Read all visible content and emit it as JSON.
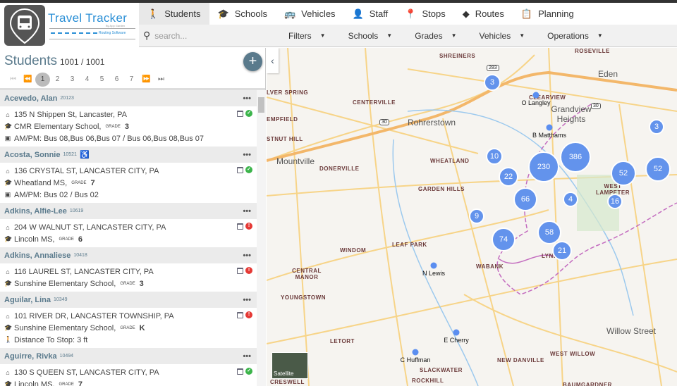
{
  "app": {
    "title": "Travel Tracker",
    "by": "By App Garden",
    "subtitle": "Routing Software"
  },
  "nav": [
    {
      "label": "Students",
      "icon": "walking-icon"
    },
    {
      "label": "Schools",
      "icon": "graduation-cap-icon"
    },
    {
      "label": "Vehicles",
      "icon": "bus-icon"
    },
    {
      "label": "Staff",
      "icon": "person-icon"
    },
    {
      "label": "Stops",
      "icon": "map-pin-icon"
    },
    {
      "label": "Routes",
      "icon": "directions-icon"
    },
    {
      "label": "Planning",
      "icon": "clipboard-icon"
    }
  ],
  "search": {
    "placeholder": "search..."
  },
  "filters": [
    "Filters",
    "Schools",
    "Grades",
    "Vehicles",
    "Operations"
  ],
  "panel": {
    "title": "Students",
    "count": "1001 / 1001",
    "pages": [
      "1",
      "2",
      "3",
      "4",
      "5",
      "6",
      "7"
    ],
    "add": "+"
  },
  "grade_label": "GRADE",
  "students": [
    {
      "name": "Acevedo, Alan",
      "id": "20123",
      "address": "135 N Shippen St, Lancaster, PA",
      "school": "CMR Elementary School,",
      "grade": "3",
      "extra": "AM/PM: Bus 08,Bus 06,Bus 07 / Bus 06,Bus 08,Bus 07",
      "status": "ok"
    },
    {
      "name": "Acosta, Sonnie",
      "id": "10521",
      "address": "136 CRYSTAL ST, LANCASTER CITY, PA",
      "school": "Wheatland MS,",
      "grade": "7",
      "extra": "AM/PM: Bus 02 / Bus 02",
      "status": "ok",
      "wheelchair": true
    },
    {
      "name": "Adkins, Alfie-Lee",
      "id": "10619",
      "address": "204 W WALNUT ST, LANCASTER CITY, PA",
      "school": "Lincoln MS,",
      "grade": "6",
      "status": "err"
    },
    {
      "name": "Adkins, Annaliese",
      "id": "10418",
      "address": "116 LAUREL ST, LANCASTER CITY, PA",
      "school": "Sunshine Elementary School,",
      "grade": "3",
      "status": "err"
    },
    {
      "name": "Aguilar, Lina",
      "id": "10349",
      "address": "101 RIVER DR, LANCASTER TOWNSHIP, PA",
      "school": "Sunshine Elementary School,",
      "grade": "K",
      "extra": "Distance To Stop: 3 ft",
      "status": "err"
    },
    {
      "name": "Aguirre, Rivka",
      "id": "10494",
      "address": "130 S QUEEN ST, LANCASTER CITY, PA",
      "school": "Lincoln MS,",
      "grade": "7",
      "status": "ok"
    }
  ],
  "map": {
    "areas": [
      "SHREINERS",
      "ROSEVILLE",
      "CLEARVIEW",
      "CENTERVILLE",
      "LVER SPRING",
      "EMPFIELD",
      "STNUT HILL",
      "DONERVILLE",
      "WHEATLAND",
      "GARDEN HILLS",
      "WEST LAMPETER",
      "LEAF PARK",
      "WINDOM",
      "CENTRAL MANOR",
      "YOUNGSTOWN",
      "WABANK",
      "LYNDON",
      "NEW DANVILLE",
      "SLACKWATER",
      "LETORT",
      "WEST WILLOW",
      "ROCKHILL",
      "CRESWELL",
      "BAUMGARDNER"
    ],
    "towns": [
      "Rohrerstown",
      "Mountville",
      "Grandview Heights",
      "Eden",
      "Willow Street"
    ],
    "highways": [
      "283",
      "30",
      "30"
    ],
    "clusters": [
      "3",
      "10",
      "22",
      "230",
      "386",
      "52",
      "52",
      "3",
      "66",
      "4",
      "16",
      "9",
      "74",
      "58",
      "21"
    ],
    "stops": [
      "O Langley",
      "B Matthams",
      "N Lewis",
      "E Cherry",
      "C Huffman"
    ],
    "satellite": "Satellite"
  }
}
